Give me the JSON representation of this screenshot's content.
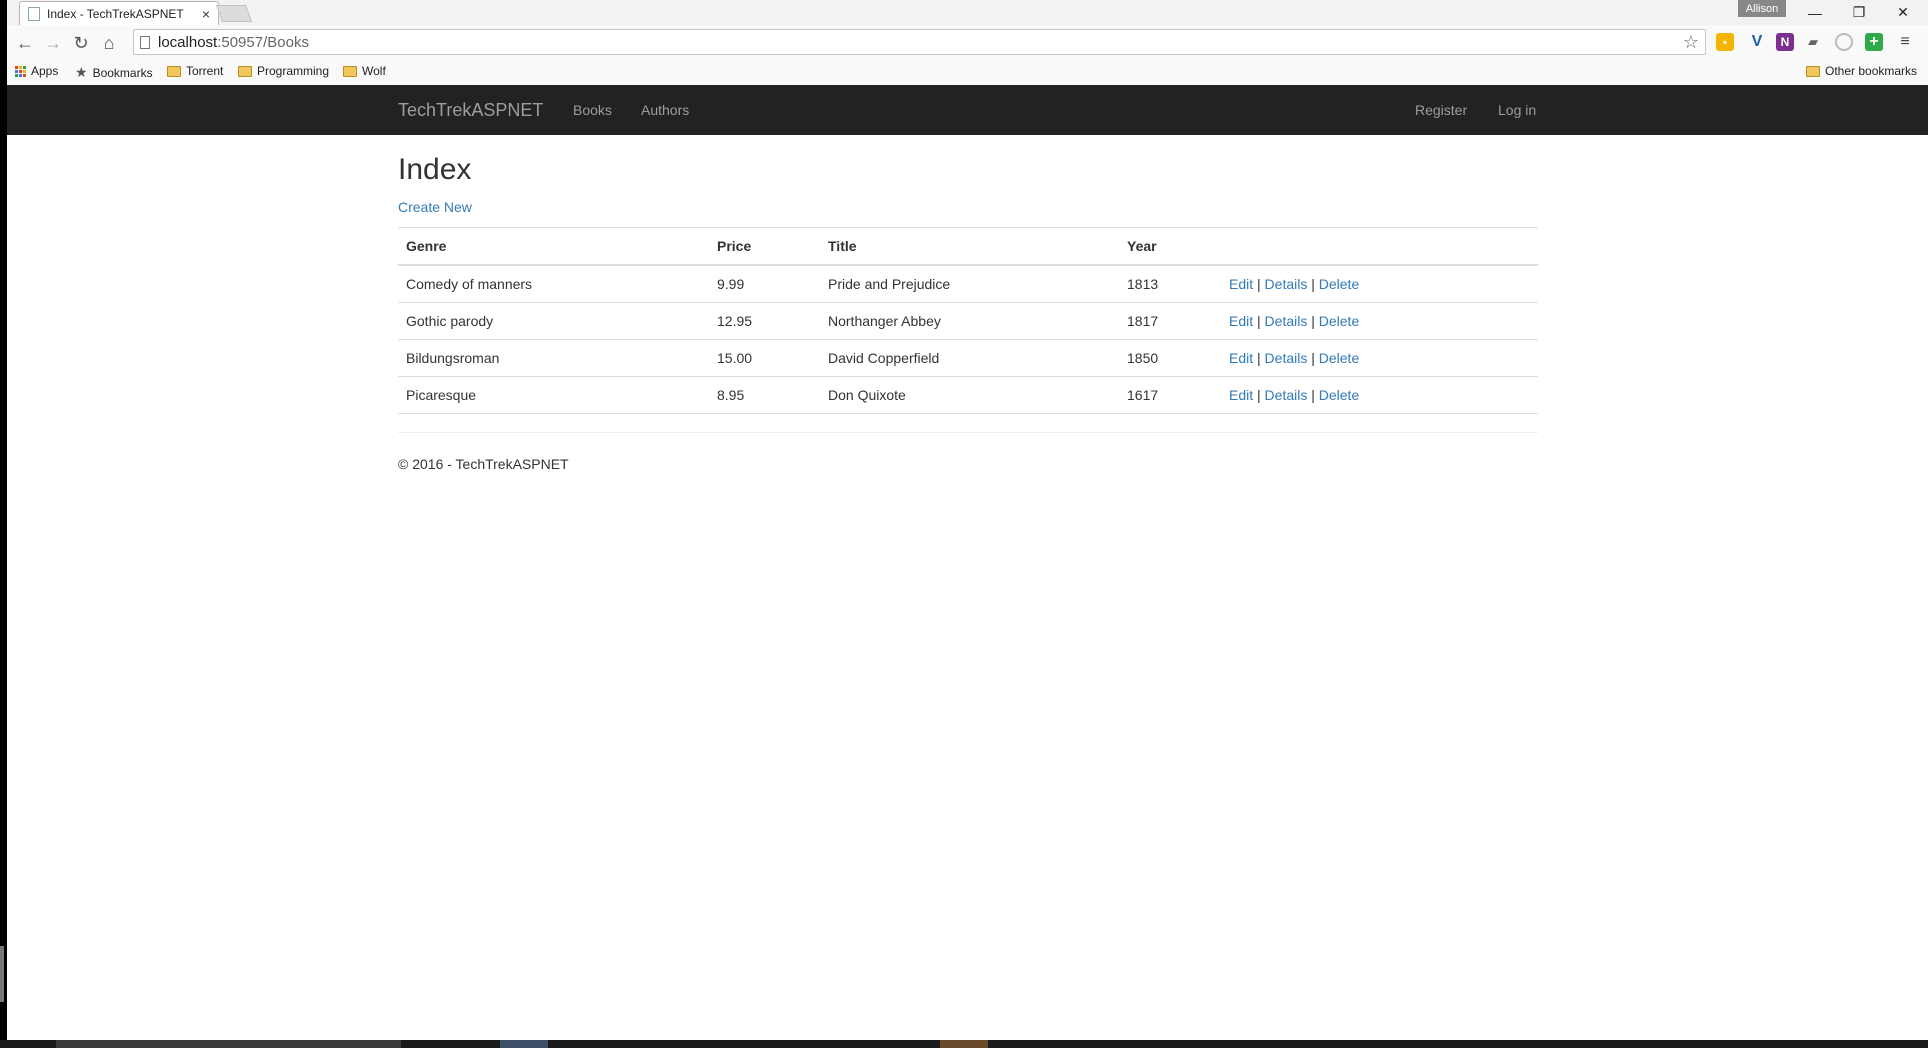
{
  "browser": {
    "tab_title": "Index - TechTrekASPNET",
    "tab_close": "×",
    "profile": "Allison",
    "window_minimize": "—",
    "window_restore": "❐",
    "window_close": "✕",
    "url_host": "localhost",
    "url_rest": ":50957/Books",
    "bookmarks": [
      {
        "label": "Apps",
        "icon": "apps-icon"
      },
      {
        "label": "Bookmarks",
        "icon": "star-icon"
      },
      {
        "label": "Torrent",
        "icon": "folder-icon"
      },
      {
        "label": "Programming",
        "icon": "folder-icon"
      },
      {
        "label": "Wolf",
        "icon": "folder-icon"
      }
    ],
    "other_bookmarks": "Other bookmarks"
  },
  "site": {
    "brand": "TechTrekASPNET",
    "nav": [
      "Books",
      "Authors"
    ],
    "account": {
      "register": "Register",
      "login": "Log in"
    }
  },
  "page": {
    "title": "Index",
    "create_new": "Create New",
    "columns": [
      "Genre",
      "Price",
      "Title",
      "Year"
    ],
    "rows": [
      {
        "genre": "Comedy of manners",
        "price": "9.99",
        "title": "Pride and Prejudice",
        "year": "1813"
      },
      {
        "genre": "Gothic parody",
        "price": "12.95",
        "title": "Northanger Abbey",
        "year": "1817"
      },
      {
        "genre": "Bildungsroman",
        "price": "15.00",
        "title": "David Copperfield",
        "year": "1850"
      },
      {
        "genre": "Picaresque",
        "price": "8.95",
        "title": "Don Quixote",
        "year": "1617"
      }
    ],
    "actions": {
      "edit": "Edit",
      "details": "Details",
      "delete": "Delete",
      "separator": "|"
    },
    "footer": "© 2016 - TechTrekASPNET"
  },
  "colors": {
    "navbar": "#222222",
    "link": "#337ab7",
    "nav_text": "#9d9d9d"
  }
}
